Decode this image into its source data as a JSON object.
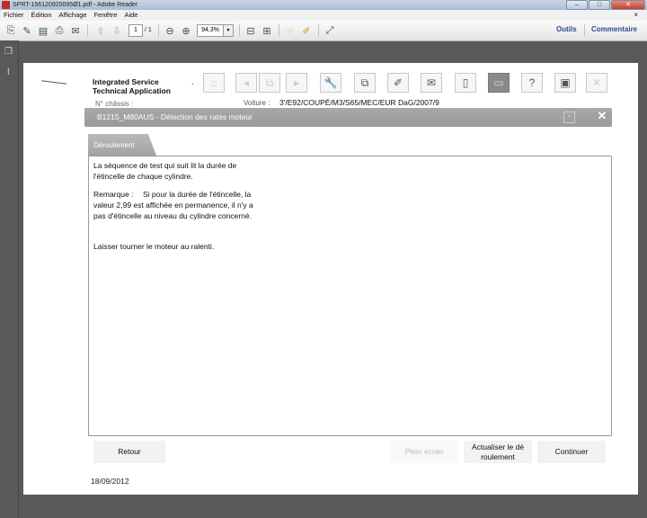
{
  "window": {
    "title": "SPRT-156120920095Ø1.pdf - Adobe Reader",
    "buttons": [
      "–",
      "□",
      "✕"
    ]
  },
  "menu": {
    "items": [
      "Fichier",
      "Édition",
      "Affichage",
      "Fenêtre",
      "Aide"
    ],
    "close": "×"
  },
  "toolbar": {
    "page_current": "1",
    "page_total": "/ 1",
    "zoom": "94,3%",
    "tools_label": "Outils",
    "comment_label": "Commentaire"
  },
  "app": {
    "title_line1": "Integrated Service",
    "title_line2": "Technical Application",
    "tick": "ˎ",
    "chassis_label": "N° châssis :",
    "voiture_label": "Voiture :",
    "voiture_value": "3'/E92/COUPÉ/M3/S65/MEC/EUR DaG/2007/9",
    "help_icon": "?"
  },
  "banner": {
    "title": "B1215_M80AUS - Détection des ratés moteur",
    "close": "✕"
  },
  "tab": {
    "label": "Déroulement"
  },
  "content": {
    "line1": "La séquence de test qui suit lit la durée de",
    "line2": "l'étincelle de chaque cylindre.",
    "remark_label": "Remarque :",
    "remark_line1": "Si pour la durée de l'étincelle, la",
    "remark_line2": "valeur 2,99 est affichée en permanence, il n'y a",
    "remark_line3": "pas d'étincelle au niveau du cylindre concerné.",
    "line3": "Laisser tourner le moteur au ralenti."
  },
  "buttons": {
    "retour": "Retour",
    "plein_ecran": "Plein écran",
    "actualiser_l1": "Actualiser le dé",
    "actualiser_l2": "roulement",
    "continuer": "Continuer"
  },
  "footer": {
    "date": "18/09/2012"
  }
}
